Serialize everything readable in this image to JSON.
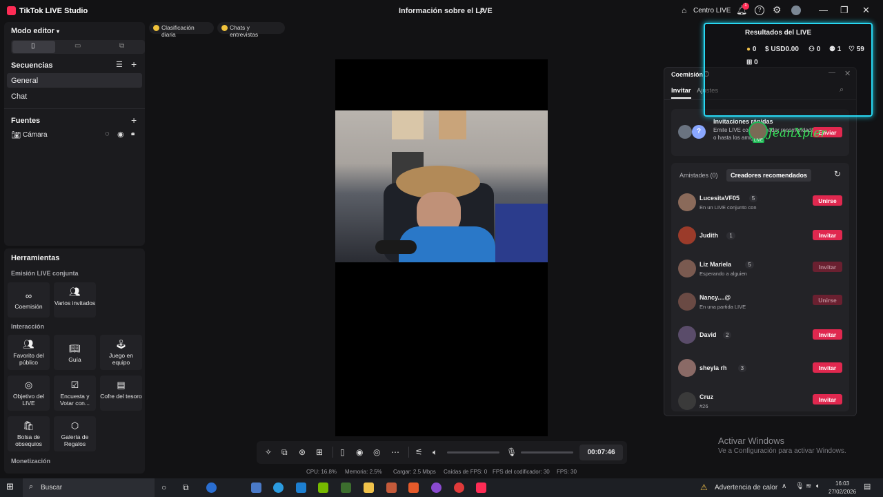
{
  "app": {
    "title": "TikTok LIVE Studio",
    "center_title": "Información sobre el LIVE",
    "home_label": "Centro LIVE",
    "notif_count": "1"
  },
  "left": {
    "mode": "Modo editor",
    "sequences_header": "Secuencias",
    "sequences": [
      "General",
      "Chat"
    ],
    "sources_header": "Fuentes",
    "source_camera": "Cámara"
  },
  "tools": {
    "header": "Herramientas",
    "section1": "Emisión LIVE conjunta",
    "section2": "Interacción",
    "section3": "Monetización",
    "items": [
      "Coemisión",
      "Varios invitados",
      "Favorito del público",
      "Guía",
      "Juego en equipo",
      "Objetivo del LIVE",
      "Encuesta y Votar con...",
      "Cofre del tesoro",
      "Bolsa de obsequios",
      "Galería de Regalos"
    ]
  },
  "pills": [
    "Clasificación diaria",
    "Chats y entrevistas"
  ],
  "results": {
    "title": "Resultados del LIVE",
    "coins": "0",
    "usd": "USD0.00",
    "viewers": "0",
    "follows": "1",
    "likes": "59",
    "gifts": "0"
  },
  "coemision": {
    "title": "Coemisión",
    "tabs": [
      "Invitar",
      "Ajustes"
    ],
    "quick_title": "Invitaciones rápidas",
    "quick_desc": "Emite LIVE con un creador recomendado o hasta los amigos",
    "quick_btn": "Enviar",
    "overlay_name": "JeanXpier",
    "overlay_live": "LIVE",
    "subtabs": [
      "Amistades (0)",
      "Creadores recomendados"
    ],
    "creators": [
      {
        "name": "LucesitaVF05",
        "count": "5",
        "status": "En un LIVE conjunto con",
        "btn": "Unirse",
        "disabled": false,
        "color": "#8a6a5a"
      },
      {
        "name": "Judith",
        "count": "1",
        "status": "",
        "btn": "Invitar",
        "disabled": false,
        "color": "#9b3b2a"
      },
      {
        "name": "Liz Mariela",
        "count": "5",
        "status": "Esperando a alguien",
        "btn": "Invitar",
        "disabled": true,
        "color": "#7a5a50"
      },
      {
        "name": "Nancy....@",
        "count": "",
        "status": "En una partida LIVE",
        "btn": "Unirse",
        "disabled": true,
        "color": "#6a4a44"
      },
      {
        "name": "David",
        "count": "2",
        "status": "",
        "btn": "Invitar",
        "disabled": false,
        "color": "#5a4c6a"
      },
      {
        "name": "sheyla rh",
        "count": "3",
        "status": "",
        "btn": "Invitar",
        "disabled": false,
        "color": "#8a6a66"
      },
      {
        "name": "Cruz",
        "count": "",
        "status": "#26",
        "btn": "Invitar",
        "disabled": false,
        "color": "#3a3a3a"
      }
    ]
  },
  "controls": {
    "timer": "00:07:46"
  },
  "stats": {
    "cpu": "CPU:  16.8%",
    "mem": "Memoria:  2.5%",
    "load": "Cargar:  2.5 Mbps",
    "fps_drop": "Caídas de FPS:  0",
    "fps_enc": "FPS del codificador:  30",
    "fps": "FPS:  30"
  },
  "watermark": {
    "line1": "Activar Windows",
    "line2": "Ve a Configuración para activar Windows."
  },
  "taskbar": {
    "search": "Buscar",
    "weather": "Advertencia de calor",
    "time": "16:03",
    "date": "27/02/2026"
  }
}
